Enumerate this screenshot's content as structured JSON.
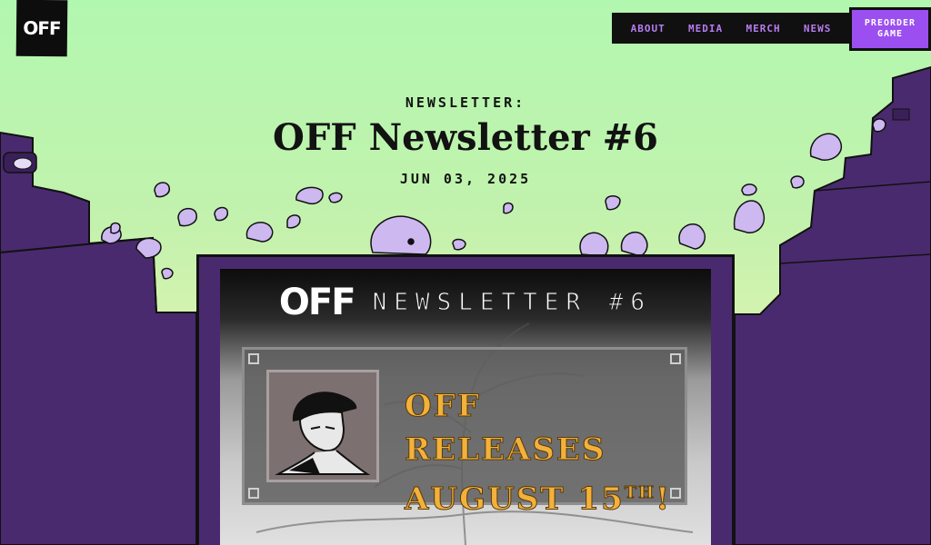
{
  "logo": {
    "text": "OFF"
  },
  "nav": {
    "items": [
      {
        "label": "ABOUT"
      },
      {
        "label": "MEDIA"
      },
      {
        "label": "MERCH"
      },
      {
        "label": "NEWS"
      }
    ],
    "cta_label": "PREORDER\nGAME"
  },
  "article": {
    "kicker": "NEWSLETTER:",
    "title": "OFF Newsletter #6",
    "date": "JUN 03, 2025"
  },
  "banner": {
    "logo_text": "OFF",
    "heading": "NEWSLETTER #6",
    "line1": "OFF RELEASES",
    "line2": "AUGUST 15",
    "line2_suffix": "TH",
    "line2_end": "!"
  },
  "colors": {
    "sky_top": "#b2f7b0",
    "sky_bottom": "#e8f4b4",
    "buildings": "#4a2a6e",
    "nav_text": "#b87cf2",
    "cta": "#9b4ff0",
    "release_text": "#f2b13a"
  },
  "icons": [
    "ghost-icon",
    "spirit-icon"
  ]
}
